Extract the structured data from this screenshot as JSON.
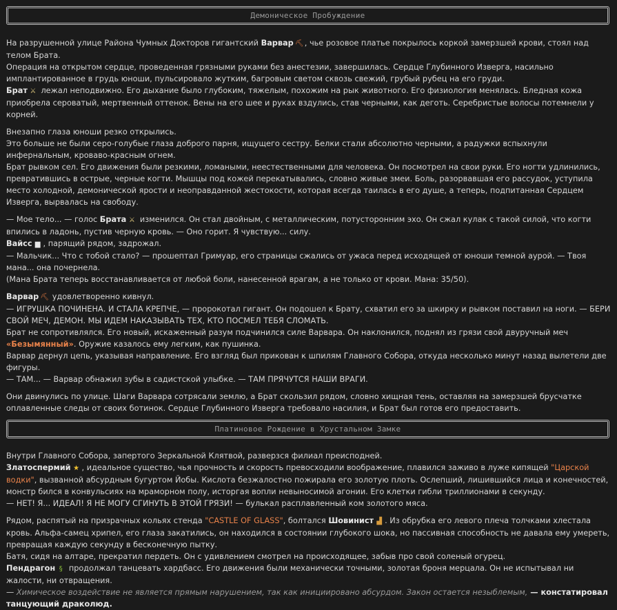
{
  "chapter1": {
    "title": "Демоническое Пробуждение",
    "p1": {
      "l1a": "На разрушенной улице Района Чумных Докторов гигантский ",
      "name_barbarian": "Варвар",
      "l1b": ", чье розовое платье покрылось коркой замерзшей крови, стоял над телом Брата.",
      "l2": "Операция на открытом сердце, проведенная грязными руками без анестезии, завершилась. Сердце Глубинного Изверга, насильно имплантированное в грудь юноши, пульсировало жутким, багровым светом сквозь свежий, грубый рубец на его груди.",
      "name_brother": "Брат",
      "l3b": " лежал неподвижно. Его дыхание было глубоким, тяжелым, похожим на рык животного. Его физиология менялась. Бледная кожа приобрела сероватый, мертвенный оттенок. Вены на его шее и руках вздулись, став черными, как деготь. Серебристые волосы потемнели у корней."
    },
    "p2": {
      "l1": "Внезапно глаза юноши резко открылись.",
      "l2": "Это больше не были серо-голубые глаза доброго парня, ищущего сестру. Белки стали абсолютно черными, а радужки вспыхнули инфернальным, кроваво-красным огнем.",
      "l3": "Брат рывком сел. Его движения были резкими, ломаными, неестественными для человека. Он посмотрел на свои руки. Его ногти удлинились, превратившись в острые, черные когти. Мышцы под кожей перекатывались, словно живые змеи. Боль, разорвавшая его рассудок, уступила место холодной, демонической ярости и неоправданной жестокости, которая всегда таилась в его душе, а теперь, подпитанная Сердцем Изверга, вырвалась на свободу."
    },
    "p3": {
      "l1a": "— Мое тело... — голос ",
      "name_brother": "Брата",
      "l1b": " изменился. Он стал двойным, с металлическим, потусторонним эхо. Он сжал кулак с такой силой, что когти впились в ладонь, пустив черную кровь. — Оно горит. Я чувствую... силу.",
      "name_weiss": "Вайсс",
      "l2b": ", парящий рядом, задрожал.",
      "l3": "— Мальчик... Что с тобой стало? — прошептал Гримуар, его страницы сжались от ужаса перед исходящей от юноши темной аурой. — Твоя мана... она почернела.",
      "l4": "(Мана Брата теперь восстанавливается от любой боли, нанесенной врагам, а не только от крови. Мана: 35/50)."
    },
    "p4": {
      "name_barbarian": "Варвар",
      "l1b": " удовлетворенно кивнул.",
      "l2": "— ИГРУШКА ПОЧИНЕНА. И СТАЛА КРЕПЧЕ, — пророкотал гигант. Он подошел к Брату, схватил его за шкирку и рывком поставил на ноги. — БЕРИ СВОЙ МЕЧ, ДЕМОН. МЫ ИДЕМ НАКАЗЫВАТЬ ТЕХ, КТО ПОСМЕЛ ТЕБЯ СЛОМАТЬ.",
      "l3a": "Брат не сопротивлялся. Его новый, искаженный разум подчинился силе Варвара. Он наклонился, поднял из грязи свой двуручный меч ",
      "sword": "«Безымянный»",
      "l3b": ". Оружие казалось ему легким, как пушинка.",
      "l4": "Варвар дернул цепь, указывая направление. Его взгляд был прикован к шпилям Главного Собора, откуда несколько минут назад вылетели две фигуры.",
      "l5": "— ТАМ... — Варвар обнажил зубы в садистской улыбке. — ТАМ ПРЯЧУТСЯ НАШИ ВРАГИ."
    },
    "p5": {
      "l1": "Они двинулись по улице. Шаги Варвара сотрясали землю, а Брат скользил рядом, словно хищная тень, оставляя на замерзшей брусчатке оплавленные следы от своих ботинок. Сердце Глубинного Изверга требовало насилия, и Брат был готов его предоставить."
    }
  },
  "chapter2": {
    "title": "Платиновое Рождение в Хрустальном Замке",
    "p1": {
      "l1": "Внутри Главного Собора, запертого Зеркальной Клятвой, разверзся филиал преисподней.",
      "name_spermius": "Златоспермий",
      "l2b": ", идеальное существо, чья прочность и скорость превосходили воображение, плавился заживо в луже кипящей ",
      "aqua": "\"Царской водки\"",
      "l2c": ", вызванной абсурдным бугуртом Йобы. Кислота безжалостно пожирала его золотую плоть. Ослепший, лишившийся лица и конечностей, монстр бился в конвульсиях на мраморном полу, исторгая вопли невыносимой агонии. Его клетки гибли триллионами в секунду.",
      "l3": "— НЕТ! Я... ИДЕАЛ! Я НЕ МОГУ СГИНУТЬ В ЭТОЙ ГРЯЗИ! — булькал расплавленный ком золотого мяса."
    },
    "p2": {
      "l1a": "Рядом, распятый на призрачных кольях стенда ",
      "castle": "\"CASTLE OF GLASS\"",
      "l1b": ", болтался ",
      "name_chauvinist": "Шовинист",
      "l1c": ". Из обрубка его левого плеча толчками хлестала кровь. Альфа-самец хрипел, его глаза закатились, он находился в состоянии глубокого шока, но пассивная способность не давала ему умереть, превращая каждую секунду в бесконечную пытку.",
      "l2": "Батя, сидя на алтаре, прекратил пердеть. Он с удивлением смотрел на происходящее, забыв про свой соленый огурец.",
      "name_pendragon": "Пендрагон",
      "l3b": " продолжал танцевать хардбасс. Его движения были механически точными, золотая броня мерцала. Он не испытывал ни жалости, ни отвращения.",
      "l4a": "— ",
      "l4_italic": "Химическое воздействие не является прямым нарушением, так как инициировано абсурдом. Закон остается незыблемым,",
      "l4b": " — констатировал танцующий драколюд."
    }
  },
  "icons": {
    "barbarian": "axe-icon",
    "brother": "wand-icon",
    "weiss": "book-icon",
    "spermius": "star-icon",
    "chauvinist": "boot-icon",
    "pendragon": "snake-icon"
  },
  "colors": {
    "background": "#1b1b1b",
    "text": "#d6d6d6",
    "highlight": "#e8824a",
    "banner_border": "#b8b8b8"
  }
}
